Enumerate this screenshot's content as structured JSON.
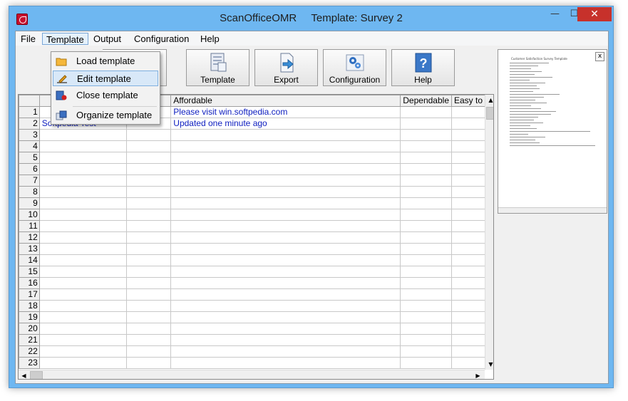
{
  "window": {
    "app_name": "ScanOfficeOMR",
    "template_caption": "Template: Survey 2",
    "min_glyph": "—",
    "max_glyph": "☐",
    "close_glyph": "✕"
  },
  "menubar": [
    "File",
    "Template",
    "Output",
    "Configuration",
    "Help"
  ],
  "dropdown": {
    "items": [
      {
        "label": "Load template",
        "icon": "folder-icon"
      },
      {
        "label": "Edit template",
        "icon": "pencil-icon"
      },
      {
        "label": "Close template",
        "icon": "close-document-icon"
      },
      {
        "label": "Organize template",
        "icon": "organize-icon"
      }
    ]
  },
  "toolbar": {
    "buttons": [
      {
        "label": "Template",
        "icon": "template-icon"
      },
      {
        "label": "Export",
        "icon": "export-icon"
      },
      {
        "label": "Configuration",
        "icon": "gears-icon"
      },
      {
        "label": "Help",
        "icon": "help-icon"
      }
    ]
  },
  "grid": {
    "columns": [
      "",
      "",
      "Affordable",
      "Dependable",
      "Easy to u"
    ],
    "rows": [
      {
        "num": "1",
        "c1": "",
        "c2": "",
        "c3": "Please visit win.softpedia.com"
      },
      {
        "num": "2",
        "c1": "Softpedia Test",
        "c2": "",
        "c3": "Updated one minute ago"
      },
      {
        "num": "3"
      },
      {
        "num": "4"
      },
      {
        "num": "5"
      },
      {
        "num": "6"
      },
      {
        "num": "7"
      },
      {
        "num": "8"
      },
      {
        "num": "9"
      },
      {
        "num": "10"
      },
      {
        "num": "11"
      },
      {
        "num": "12"
      },
      {
        "num": "13"
      },
      {
        "num": "14"
      },
      {
        "num": "15"
      },
      {
        "num": "16"
      },
      {
        "num": "17"
      },
      {
        "num": "18"
      },
      {
        "num": "19"
      },
      {
        "num": "20"
      },
      {
        "num": "21"
      },
      {
        "num": "22"
      },
      {
        "num": "23"
      }
    ]
  },
  "preview": {
    "title": "Customer Satisfaction Survey Template",
    "close_glyph": "x"
  },
  "colors": {
    "title_bar": "#6eb7f1",
    "close_button": "#c7312b",
    "grid_text_blue": "#1020c0",
    "menu_highlight": "#d8e8f8"
  }
}
